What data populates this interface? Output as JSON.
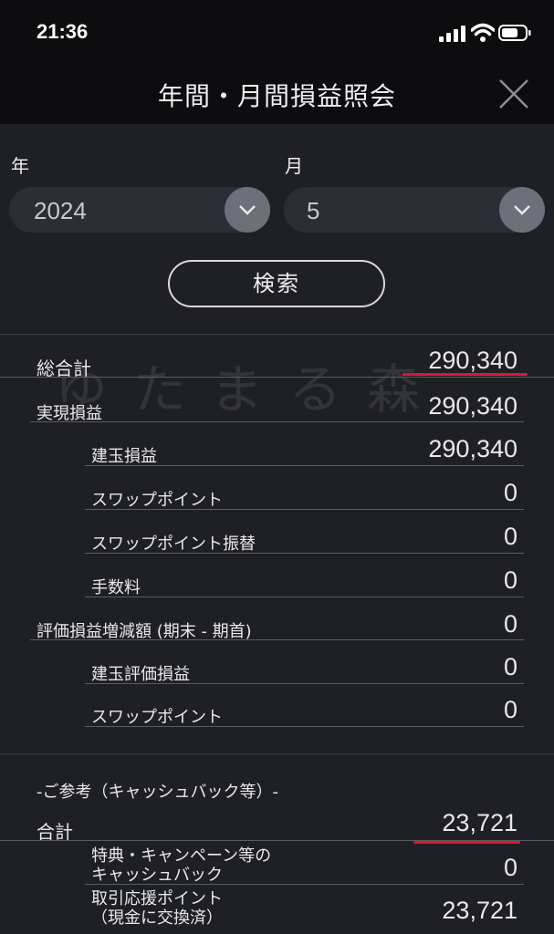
{
  "status_bar": {
    "time": "21:36"
  },
  "header": {
    "title": "年間・月間損益照会"
  },
  "form": {
    "year_label": "年",
    "year_value": "2024",
    "month_label": "月",
    "month_value": "5",
    "search_label": "検索"
  },
  "watermark": "ゆたまる森",
  "rows": {
    "total": {
      "label": "総合計",
      "value": "290,340"
    },
    "realized": {
      "label": "実現損益",
      "value": "290,340"
    },
    "position_pl": {
      "label": "建玉損益",
      "value": "290,340"
    },
    "swap": {
      "label": "スワップポイント",
      "value": "0"
    },
    "swap_transfer": {
      "label": "スワップポイント振替",
      "value": "0"
    },
    "fee": {
      "label": "手数料",
      "value": "0"
    },
    "valuation_change": {
      "label": "評価損益増減額 (期末 - 期首)",
      "value": "0"
    },
    "position_valuation": {
      "label": "建玉評価損益",
      "value": "0"
    },
    "swap2": {
      "label": "スワップポイント",
      "value": "0"
    }
  },
  "reference": {
    "title": "-ご参考（キャッシュバック等）-",
    "total": {
      "label": "合計",
      "value": "23,721"
    },
    "campaign": {
      "label_line1": "特典・キャンペーン等の",
      "label_line2": "キャッシュバック",
      "value": "0"
    },
    "points": {
      "label_line1": "取引応援ポイント",
      "label_line2": "（現金に交換済）",
      "value": "23,721"
    }
  },
  "colors": {
    "background": "#1f2026",
    "header": "#0d0d10",
    "highlight_underline": "#e0182d"
  },
  "icons": [
    "signal-icon",
    "wifi-icon",
    "battery-icon",
    "close-icon",
    "chevron-down-icon"
  ]
}
